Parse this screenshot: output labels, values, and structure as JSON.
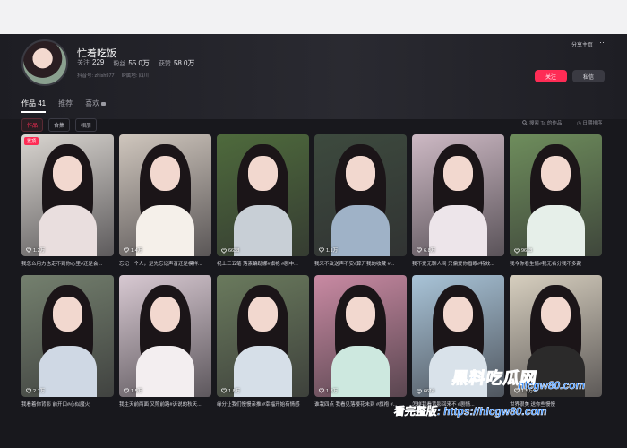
{
  "profile": {
    "name": "忙着吃饭",
    "following_label": "关注",
    "following": "229",
    "fans_label": "粉丝",
    "fans": "55.0万",
    "likes_label": "获赞",
    "likes": "58.0万",
    "account_id": "抖音号: zhish977",
    "ip_location": "IP属地: 四川",
    "share_label": "分享主页",
    "more_icon": "more-icon",
    "follow_button": "关注",
    "message_button": "私信"
  },
  "tabs": [
    {
      "label": "作品 41",
      "active": true
    },
    {
      "label": "推荐",
      "active": false
    },
    {
      "label": "喜欢",
      "active": false,
      "locked": true
    }
  ],
  "subtabs": [
    {
      "label": "作品",
      "active": true
    },
    {
      "label": "合集",
      "active": false
    },
    {
      "label": "相册",
      "active": false
    }
  ],
  "search_placeholder": "搜索 Ta 的作品",
  "sort_label": "日期排序",
  "colors": {
    "accent": "#fe2c55",
    "background": "#18181d"
  },
  "videos": [
    {
      "likes": "1.2万",
      "caption": "我怎么用力也走不到你心里#还是会...",
      "badge": "置顶",
      "bg": "#d9d5d0",
      "body": "#e9dede"
    },
    {
      "likes": "1.4万",
      "caption": "忘记一个人，是先忘记声音还是模样...",
      "bg": "#cfc6bd",
      "body": "#f5f0ea"
    },
    {
      "likes": "6638",
      "caption": "祝上三五笔 落素蹁跹娜#旗袍 #剧中...",
      "bg": "#4e6a3c",
      "body": "#c8cfd6"
    },
    {
      "likes": "1.1万",
      "caption": "我来不及送声不安#算开我的收藏 #...",
      "bg": "#3d4a3e",
      "body": "#9fb2c7"
    },
    {
      "likes": "6.8万",
      "caption": "我不爱无聊人间 只偏爱你眉眼#特效...",
      "bg": "#cdb9c4",
      "body": "#ede5ea"
    },
    {
      "likes": "9613",
      "caption": "我今你看生情#我无名分我不多藏",
      "bg": "#6e8d5c",
      "body": "#e6efe9"
    },
    {
      "likes": "2.1万",
      "caption": "我看着你背影 前开口#心似魔火",
      "bg": "#74806e",
      "body": "#cfd8e4"
    },
    {
      "likes": "1.5万",
      "caption": "我生天前两面 又照前路#诉说的秋天...",
      "bg": "#d8c9d2",
      "body": "#f3eef0"
    },
    {
      "likes": "1.8万",
      "caption": "缘分让我们慢慢亲推 #幸福开始有情感",
      "bg": "#6a7a5d",
      "body": "#d6dfe8"
    },
    {
      "likes": "1.3万",
      "caption": "谁栽四点 我看见落樱花未到 #旗袍 #...",
      "bg": "#c98aa3",
      "body": "#cde8df"
    },
    {
      "likes": "6614",
      "caption": "怎样我看背影回来不 #剧情...",
      "bg": "#a9c4d8",
      "body": "#d9e2ea"
    },
    {
      "likes": "1.5万",
      "caption": "世界很美 送你些慢慢",
      "bg": "#d7cfbf",
      "body": "#2b2a2a"
    }
  ],
  "watermark": {
    "brand": "黑料吃瓜网",
    "domain": "hlcgw80.com",
    "notice": "看完整版: https://hlcgw80.com"
  }
}
